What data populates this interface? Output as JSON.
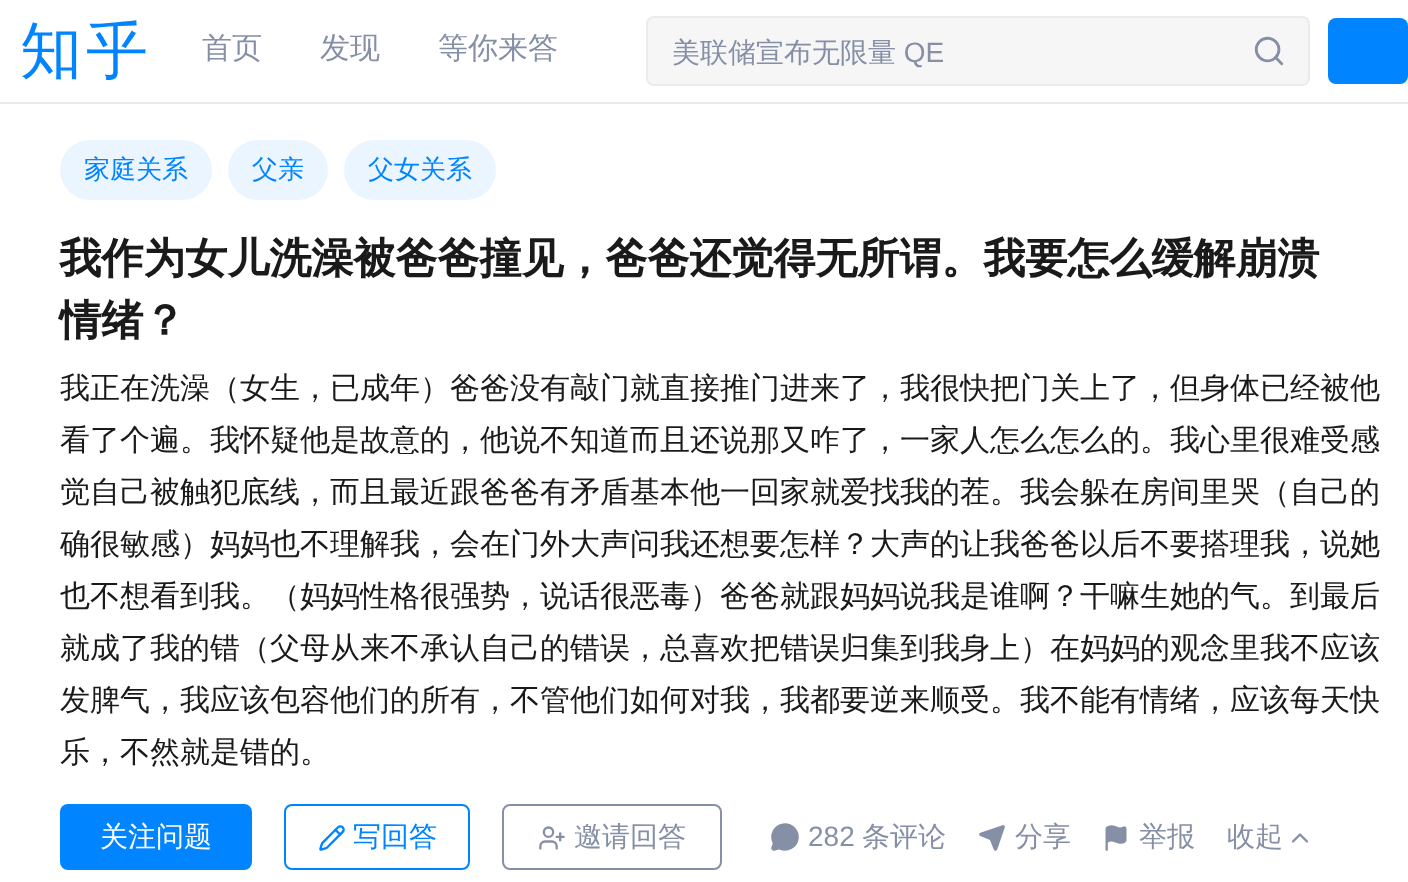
{
  "header": {
    "logo": "知乎",
    "nav": [
      {
        "label": "首页",
        "selected": false
      },
      {
        "label": "发现",
        "selected": false
      },
      {
        "label": "等你来答",
        "selected": false
      }
    ],
    "search": {
      "placeholder": "美联储宣布无限量 QE"
    }
  },
  "question": {
    "topics": [
      "家庭关系",
      "父亲",
      "父女关系"
    ],
    "title": "我作为女儿洗澡被爸爸撞见，爸爸还觉得无所谓。我要怎么缓解崩溃情绪？",
    "body": "我正在洗澡（女生，已成年）爸爸没有敲门就直接推门进来了，我很快把门关上了，但身体已经被他看了个遍。我怀疑他是故意的，他说不知道而且还说那又咋了，一家人怎么怎么的。我心里很难受感觉自己被触犯底线，而且最近跟爸爸有矛盾基本他一回家就爱找我的茬。我会躲在房间里哭（自己的确很敏感）妈妈也不理解我，会在门外大声问我还想要怎样？大声的让我爸爸以后不要搭理我，说她也不想看到我。（妈妈性格很强势，说话很恶毒）爸爸就跟妈妈说我是谁啊？干嘛生她的气。到最后就成了我的错（父母从来不承认自己的错误，总喜欢把错误归集到我身上）在妈妈的观念里我不应该发脾气，我应该包容他们的所有，不管他们如何对我，我都要逆来顺受。我不能有情绪，应该每天快乐，不然就是错的。",
    "actions": [
      {
        "kind": "primary",
        "label": "关注问题"
      },
      {
        "kind": "outline",
        "label": "写回答"
      },
      {
        "kind": "plain",
        "label": "邀请回答"
      },
      {
        "kind": "comment",
        "label": "282 条评论"
      },
      {
        "kind": "share",
        "label": "分享"
      },
      {
        "kind": "report",
        "label": "举报"
      },
      {
        "kind": "collapse",
        "label": "收起"
      }
    ]
  }
}
